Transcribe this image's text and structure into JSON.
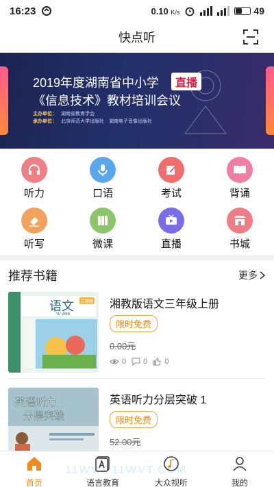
{
  "status": {
    "time": "16:23",
    "speed": "0.10",
    "speed_unit": "K/s",
    "battery": "49",
    "battery_level": 0.49
  },
  "header": {
    "title": "快点听"
  },
  "banner": {
    "line1": "2019年度湖南省中小学",
    "badge": "直播",
    "line2": "《信息技术》教材培训会议",
    "organizer_label": "主办单位：",
    "organizer": "湖南省教育学会",
    "co_label": "承办单位：",
    "co_organizers": "北京师范大学出版社　湖南电子音像出版社"
  },
  "menu": [
    {
      "label": "听力",
      "icon": "headphones-icon",
      "color": "#ef7f86"
    },
    {
      "label": "口语",
      "icon": "microphone-icon",
      "color": "#5aa7ee"
    },
    {
      "label": "考试",
      "icon": "pen-icon",
      "color": "#f06d6d"
    },
    {
      "label": "背诵",
      "icon": "book-icon",
      "color": "#f07da2"
    },
    {
      "label": "听写",
      "icon": "eraser-icon",
      "color": "#f2a25c"
    },
    {
      "label": "微课",
      "icon": "books-icon",
      "color": "#8cc66a"
    },
    {
      "label": "直播",
      "icon": "tv-icon",
      "color": "#7a6ee8"
    },
    {
      "label": "书城",
      "icon": "store-icon",
      "color": "#f07d86"
    }
  ],
  "recommend": {
    "title": "推荐书籍",
    "more": "更多",
    "books": [
      {
        "title": "湘教版语文三年级上册",
        "tag": "限时免费",
        "price": "0.00元",
        "views": "0",
        "comments": "0",
        "likes": "0",
        "cover_title": "语文",
        "cover_sub": "YU WEN",
        "cover_grade": "三年级"
      },
      {
        "title": "英语听力分层突破  1",
        "tag": "限时免费",
        "price": "52.00元",
        "cover_title": "英语听力分层突破"
      }
    ]
  },
  "nav": [
    {
      "label": "首页",
      "icon": "home-icon",
      "active": true
    },
    {
      "label": "语言教育",
      "icon": "language-icon",
      "active": false
    },
    {
      "label": "大众视听",
      "icon": "music-icon",
      "active": false
    },
    {
      "label": "我的",
      "icon": "user-icon",
      "active": false
    }
  ],
  "watermark": "11WVT  11WVT.COM"
}
